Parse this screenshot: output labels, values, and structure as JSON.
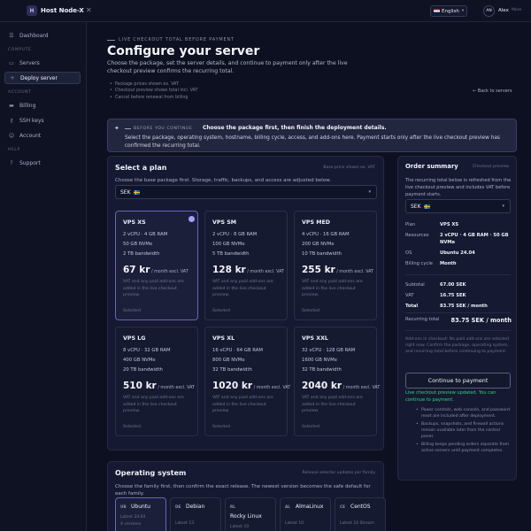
{
  "app": {
    "logo_letter": "H",
    "name": "Host Node-X",
    "language": "English",
    "user_initials": "AN",
    "user_name": "Alex",
    "more": "More"
  },
  "sidebar": {
    "items": [
      {
        "label": "Dashboard",
        "icon": "grid-icon"
      },
      {
        "label": "Servers",
        "icon": "server-icon"
      },
      {
        "label": "Deploy server",
        "icon": "plus-icon",
        "active": true
      },
      {
        "label": "Billing",
        "icon": "card-icon"
      },
      {
        "label": "SSH keys",
        "icon": "key-icon"
      },
      {
        "label": "Account",
        "icon": "user-icon"
      },
      {
        "label": "Support",
        "icon": "help-icon"
      }
    ],
    "sections": [
      "COMPUTE",
      "ACCOUNT",
      "HELP"
    ]
  },
  "header": {
    "eyebrow": "LIVE CHECKOUT TOTAL BEFORE PAYMENT",
    "title": "Configure your server",
    "subtitle": "Choose the package, set the server details, and continue to payment only after the live checkout preview confirms the recurring total.",
    "bullets": [
      "Package prices shown ex. VAT",
      "Checkout preview shows total incl. VAT",
      "Cancel before renewal from billing"
    ],
    "back_link": "← Back to servers"
  },
  "banner": {
    "eyebrow": "BEFORE YOU CONTINUE",
    "title": "Choose the package first, then finish the deployment details.",
    "text": "Select the package, operating system, hostname, billing cycle, access, and add-ons here. Payment starts only after the live checkout preview has confirmed the recurring total."
  },
  "plans": {
    "title": "Select a plan",
    "note": "Base price shown ex. VAT",
    "description": "Choose the base package first. Storage, traffic, backups, and access are adjusted below.",
    "currency": "SEK",
    "items": [
      {
        "name": "VPS XS",
        "cpu_ram": "2 vCPU · 4 GB RAM",
        "disk": "50 GB NVMe",
        "bandwidth": "2 TB bandwidth",
        "price": "67 kr",
        "per": " / month excl. VAT",
        "vat_note": "VAT and any paid add-ons are added in the live checkout preview.",
        "status": "Selected",
        "selected": true
      },
      {
        "name": "VPS SM",
        "cpu_ram": "2 vCPU · 8 GB RAM",
        "disk": "100 GB NVMe",
        "bandwidth": "5 TB bandwidth",
        "price": "128 kr",
        "per": " / month excl. VAT",
        "vat_note": "VAT and any paid add-ons are added in the live checkout preview.",
        "status": "Selected"
      },
      {
        "name": "VPS MED",
        "cpu_ram": "4 vCPU · 16 GB RAM",
        "disk": "200 GB NVMe",
        "bandwidth": "10 TB bandwidth",
        "price": "255 kr",
        "per": " / month excl. VAT",
        "vat_note": "VAT and any paid add-ons are added in the live checkout preview.",
        "status": "Selected"
      },
      {
        "name": "VPS LG",
        "cpu_ram": "8 vCPU · 32 GB RAM",
        "disk": "400 GB NVMe",
        "bandwidth": "20 TB bandwidth",
        "price": "510 kr",
        "per": " / month excl. VAT",
        "vat_note": "VAT and any paid add-ons are added in the live checkout preview.",
        "status": "Selected"
      },
      {
        "name": "VPS XL",
        "cpu_ram": "16 vCPU · 64 GB RAM",
        "disk": "800 GB NVMe",
        "bandwidth": "32 TB bandwidth",
        "price": "1020 kr",
        "per": " / month excl. VAT",
        "vat_note": "VAT and any paid add-ons are added in the live checkout preview.",
        "status": "Selected"
      },
      {
        "name": "VPS XXL",
        "cpu_ram": "32 vCPU · 128 GB RAM",
        "disk": "1600 GB NVMe",
        "bandwidth": "32 TB bandwidth",
        "price": "2040 kr",
        "per": " / month excl. VAT",
        "vat_note": "VAT and any paid add-ons are added in the live checkout preview.",
        "status": "Selected"
      }
    ]
  },
  "os": {
    "title": "Operating system",
    "note": "Release selector updates per family",
    "description": "Choose the family first, then confirm the exact release. The newest version becomes the safe default for each family.",
    "items": [
      {
        "code": "UB",
        "name": "Ubuntu",
        "latest": "Latest 24.04",
        "versions": "4 versions",
        "selected": true
      },
      {
        "code": "DE",
        "name": "Debian",
        "latest": "Latest 13"
      },
      {
        "code": "RL",
        "name": "Rocky Linux",
        "latest": "Latest 10"
      },
      {
        "code": "AL",
        "name": "AlmaLinux",
        "latest": "Latest 10"
      },
      {
        "code": "CE",
        "name": "CentOS",
        "latest": "Latest 10 Stream"
      }
    ]
  },
  "summary": {
    "title": "Order summary",
    "note": "Checkout preview",
    "description": "The recurring total below is refreshed from the live checkout preview and includes VAT before payment starts.",
    "currency": "SEK",
    "plan_label": "Plan",
    "plan_value": "VPS XS",
    "resources_label": "Resources",
    "resources_value": "2 vCPU · 4 GB RAM · 50 GB NVMe",
    "os_label": "OS",
    "os_value": "Ubuntu 24.04",
    "cycle_label": "Billing cycle",
    "cycle_value": "Month",
    "subtotal_label": "Subtotal",
    "subtotal_value": "67.00 SEK",
    "vat_label": "VAT",
    "vat_value": "16.75 SEK",
    "total_label": "Total",
    "total_value": "83.75 SEK / month",
    "recurring_label": "Recurring total",
    "recurring_value": "83.75 SEK / month",
    "addons_note": "Add-ons in checkout: No paid add-ons are selected right now. Confirm the package, operating system, and recurring total before continuing to payment.",
    "pay_button": "Continue to payment",
    "success": "Live checkout preview updated. You can continue to payment.",
    "bullets": [
      "Power controls, web console, and password reset are included after deployment.",
      "Backups, snapshots, and firewall actions remain available later from the control panel.",
      "Billing keeps pending orders separate from active servers until payment completes."
    ]
  }
}
